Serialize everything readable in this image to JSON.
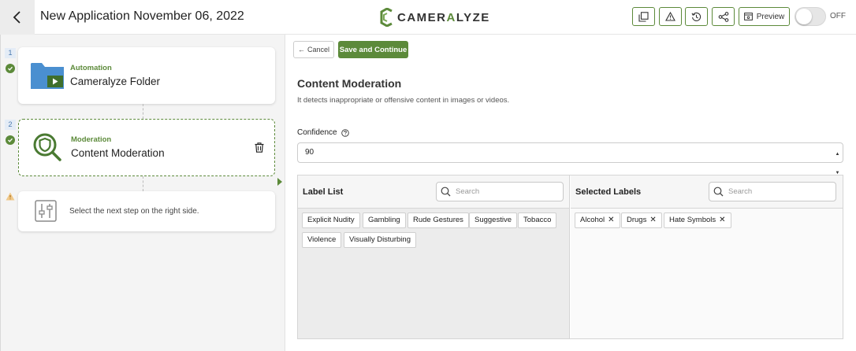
{
  "header": {
    "title": "New Application November 06, 2022",
    "logo_prefix": "CAMER",
    "logo_accent": "A",
    "logo_suffix": "LYZE",
    "preview_label": "Preview",
    "toggle_label": "OFF",
    "brand_color": "#5c8a3a"
  },
  "steps": [
    {
      "number": "1",
      "category": "Automation",
      "title": "Cameralyze Folder",
      "icon": "folder-video-icon",
      "status": "complete"
    },
    {
      "number": "2",
      "category": "Moderation",
      "title": "Content Moderation",
      "icon": "moderation-search-icon",
      "status": "complete"
    },
    {
      "hint": "Select the next step on the right side.",
      "icon": "sliders-icon",
      "status": "warning"
    }
  ],
  "panel": {
    "cancel_label": "Cancel",
    "save_label": "Save and Continue",
    "title": "Content Moderation",
    "description": "It detects inappropriate or offensive content in images or videos.",
    "confidence_label": "Confidence",
    "confidence_value": "90",
    "label_list_title": "Label List",
    "selected_labels_title": "Selected Labels",
    "search_placeholder": "Search",
    "available_labels": [
      "Explicit Nudity",
      "Gambling",
      "Rude Gestures",
      "Suggestive",
      "Tobacco",
      "Violence",
      "Visually Disturbing"
    ],
    "selected_labels": [
      "Alcohol",
      "Drugs",
      "Hate Symbols"
    ]
  }
}
